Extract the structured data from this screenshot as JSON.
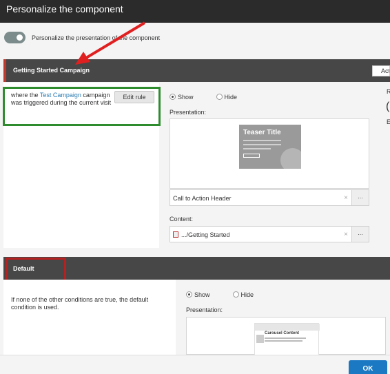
{
  "dialog": {
    "title": "Personalize the component"
  },
  "toggle": {
    "label": "Personalize the presentation of the component",
    "on": true
  },
  "conditions": [
    {
      "header": "Getting Started Campaign",
      "actions_label": "Actions",
      "rule_text_pre": "where the",
      "rule_link": "Test Campaign",
      "rule_text_post": "campaign was triggered during the current visit",
      "edit_rule_label": "Edit rule",
      "show_label": "Show",
      "hide_label": "Hide",
      "presentation_label": "Presentation:",
      "presentation_value": "Call to Action Header",
      "preview_title": "Teaser Title",
      "content_label": "Content:",
      "content_value": ".../Getting Started",
      "more_button": "..."
    },
    {
      "header": "Default",
      "rule_text": "If none of the other conditions are true, the default condition is used.",
      "show_label": "Show",
      "hide_label": "Hide",
      "presentation_label": "Presentation:",
      "preview_title": "Carousel Content"
    }
  ],
  "footer": {
    "ok_label": "OK"
  },
  "colors": {
    "title_bg": "#2b2b2b",
    "header_bg": "#474747",
    "accent_red": "#c0392b",
    "link_blue": "#2a7ab0",
    "ok_blue": "#1b78c2",
    "annotation_green": "#2e8b2e",
    "annotation_red": "#b52020"
  }
}
